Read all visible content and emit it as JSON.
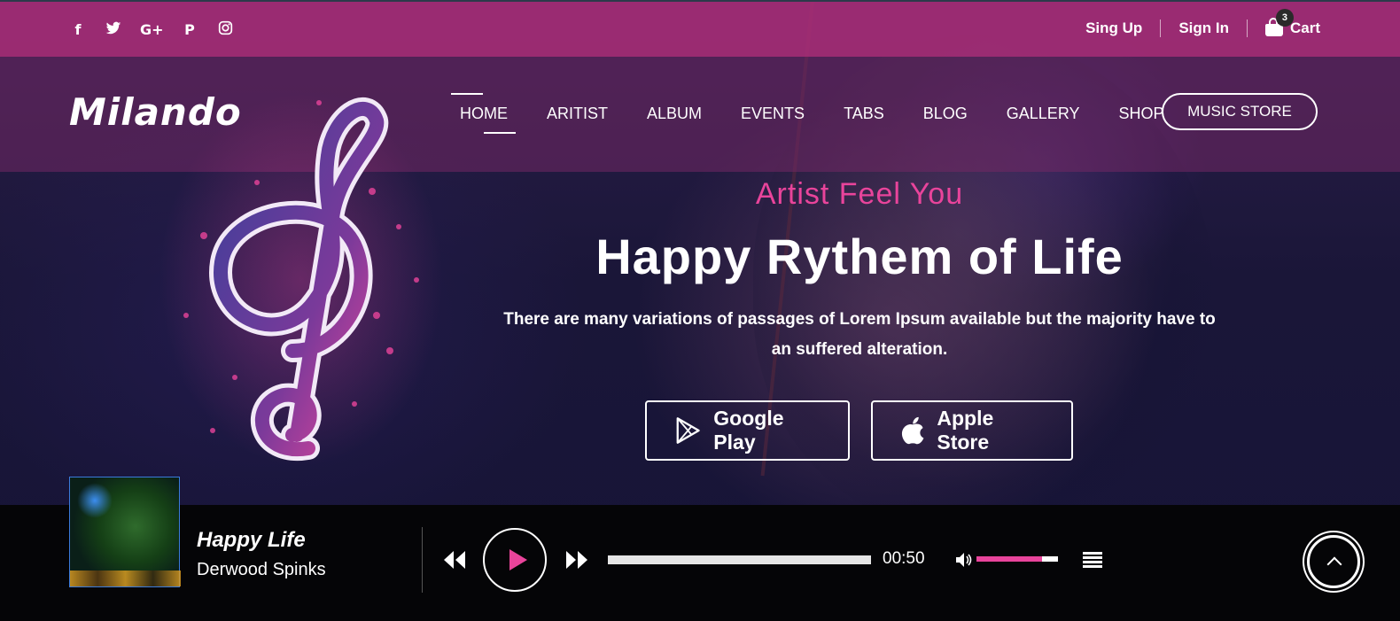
{
  "topbar": {
    "social": [
      {
        "name": "facebook-icon",
        "glyph": "f"
      },
      {
        "name": "twitter-icon",
        "glyph": "🐦"
      },
      {
        "name": "google-plus-icon",
        "glyph": "G+"
      },
      {
        "name": "pinterest-icon",
        "glyph": "P"
      },
      {
        "name": "instagram-icon",
        "glyph": "◎"
      }
    ],
    "sign_up": "Sing Up",
    "sign_in": "Sign In",
    "cart_label": "Cart",
    "cart_count": "3"
  },
  "nav": {
    "logo": "Milando",
    "items": [
      "HOME",
      "ARITIST",
      "ALBUM",
      "EVENTS",
      "TABS",
      "BLOG",
      "GALLERY",
      "SHOP"
    ],
    "active": "HOME",
    "store_button": "MUSIC STORE"
  },
  "hero": {
    "kicker": "Artist Feel You",
    "headline": "Happy Rythem of Life",
    "description": "There are many variations of passages of Lorem Ipsum available but the majority have to an suffered alteration.",
    "google_play": "Google Play",
    "apple_store": "Apple Store"
  },
  "player": {
    "song_title": "Happy Life",
    "artist": "Derwood Spinks",
    "time": "00:50",
    "progress": 1.0,
    "volume": 0.8
  },
  "colors": {
    "accent": "#e9449b",
    "topbar": "#aa2d78",
    "player_bg": "#050507"
  },
  "icons": {
    "prev": "rewind-icon",
    "play": "play-icon",
    "next": "fast-forward-icon",
    "volume": "volume-icon",
    "playlist": "playlist-icon",
    "scroll_top": "chevron-up-icon",
    "google_play": "google-play-icon",
    "apple": "apple-icon",
    "cart": "cart-icon",
    "clef": "treble-clef-icon"
  }
}
